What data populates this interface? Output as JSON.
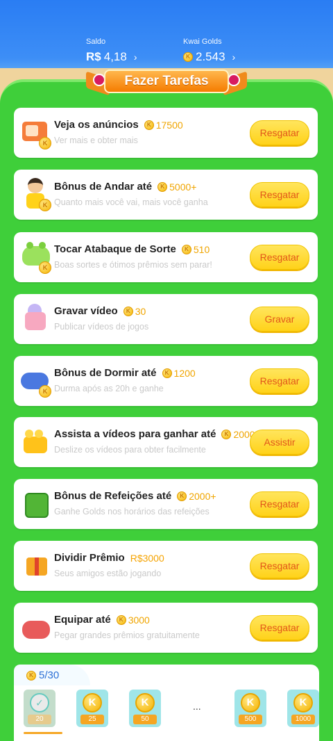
{
  "header": {
    "saldo_label": "Saldo",
    "saldo_currency": "R$",
    "saldo_value": "4,18",
    "golds_label": "Kwai Golds",
    "golds_value": "2.543",
    "chevron": "›"
  },
  "banner": {
    "title": "Fazer Tarefas"
  },
  "tasks": [
    {
      "title": "Veja os anúncios",
      "reward": "17500",
      "subtitle": "Ver mais e obter mais",
      "button": "Resgatar",
      "icon": "tv-ad-icon"
    },
    {
      "title": "Bônus de Andar até",
      "reward": "5000+",
      "subtitle": "Quanto mais você vai, mais você ganha",
      "button": "Resgatar",
      "icon": "walking-kid-icon"
    },
    {
      "title": "Tocar Atabaque de Sorte",
      "reward": "510",
      "subtitle": "Boas sortes e ótimos prêmios sem parar!",
      "button": "Resgatar",
      "icon": "lucky-drum-icon"
    },
    {
      "title": "Gravar vídeo",
      "reward": "30",
      "subtitle": "Publicar vídeos de jogos",
      "button": "Gravar",
      "icon": "record-camera-icon"
    },
    {
      "title": "Bônus de Dormir até",
      "reward": "1200",
      "subtitle": "Durma após as 20h e ganhe",
      "button": "Resgatar",
      "icon": "sleep-moon-icon"
    },
    {
      "title": "Assista a vídeos para ganhar até",
      "reward": "2000",
      "subtitle": "Deslize os vídeos para obter facilmente",
      "button": "Assistir",
      "icon": "video-projector-icon"
    },
    {
      "title": "Bônus de Refeições até",
      "reward": "2000+",
      "subtitle": "Ganhe Golds nos horários das refeições",
      "button": "Resgatar",
      "icon": "lunchbox-icon"
    },
    {
      "title": "Dividir Prêmio",
      "reward": "R$3000",
      "subtitle": "Seus amigos estão jogando",
      "button": "Resgatar",
      "icon": "gift-box-icon"
    },
    {
      "title": "Equipar até",
      "reward": "3000",
      "subtitle": "Pegar grandes prêmios gratuitamente",
      "button": "Resgatar",
      "icon": "boxing-glove-icon"
    }
  ],
  "checkin": {
    "progress": "5/30",
    "days": [
      {
        "amount": "20",
        "done": true
      },
      {
        "amount": "25",
        "done": false
      },
      {
        "amount": "50",
        "done": false
      },
      {
        "amount": "500",
        "done": false
      },
      {
        "amount": "1000",
        "done": false
      }
    ],
    "ellipsis": "...",
    "coin_letter": "K"
  },
  "colors": {
    "panel_green": "#3fcf3a",
    "button_yellow": "#ffd21a",
    "button_text": "#e2561a",
    "reward_gold": "#f0a500",
    "header_blue": "#2a7df3"
  }
}
